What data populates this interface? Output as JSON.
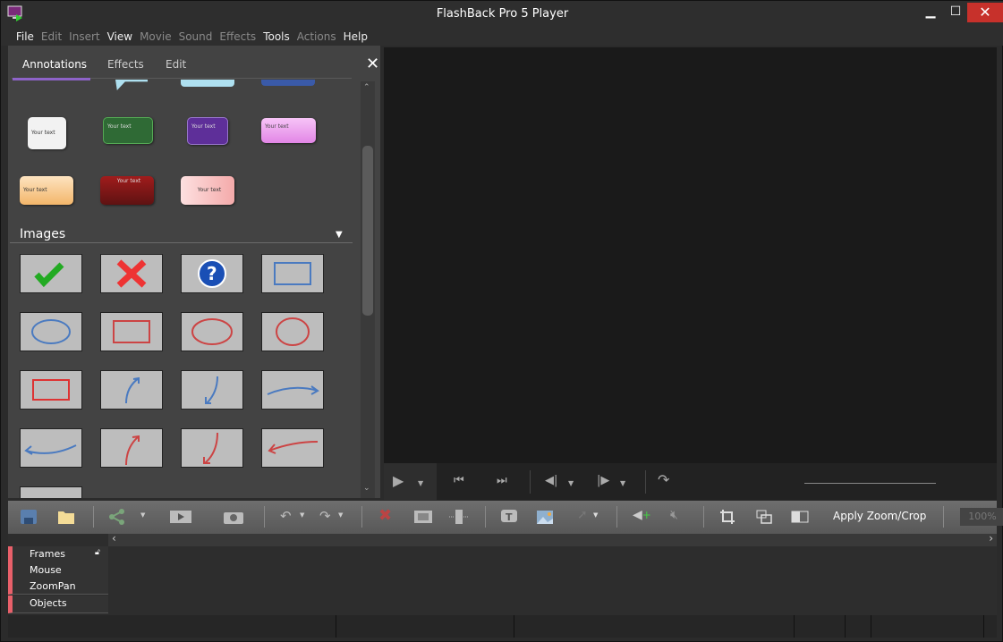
{
  "window": {
    "title": "FlashBack Pro 5 Player",
    "minimize": "▁",
    "maximize": "☐",
    "close": "✕"
  },
  "menu": [
    {
      "label": "File",
      "enabled": true
    },
    {
      "label": "Edit",
      "enabled": false
    },
    {
      "label": "Insert",
      "enabled": false
    },
    {
      "label": "View",
      "enabled": true
    },
    {
      "label": "Movie",
      "enabled": false
    },
    {
      "label": "Sound",
      "enabled": false
    },
    {
      "label": "Effects",
      "enabled": false
    },
    {
      "label": "Tools",
      "enabled": true
    },
    {
      "label": "Actions",
      "enabled": false
    },
    {
      "label": "Help",
      "enabled": true
    }
  ],
  "panel": {
    "tabs": [
      "Annotations",
      "Effects",
      "Edit"
    ],
    "active_tab": "Annotations",
    "close": "✕",
    "callouts": [
      {
        "text": "Your text",
        "color": "#f2f2f2",
        "fg": "#333"
      },
      {
        "text": "Your text",
        "color": "#2f6a35",
        "fg": "#ddd"
      },
      {
        "text": "Your text",
        "color": "#5e2f99",
        "fg": "#ddd"
      },
      {
        "text": "Your text",
        "color": "#f0a6f0",
        "fg": "#444"
      },
      {
        "text": "Your text",
        "color": "#f8c888",
        "fg": "#333"
      },
      {
        "text": "Your text",
        "color": "#8a1a1a",
        "fg": "#ddd"
      },
      {
        "text": "Your text",
        "color": "#f8c8c8",
        "fg": "#333"
      }
    ],
    "images_section": "Images",
    "images": [
      "green-checkmark",
      "red-x",
      "blue-question",
      "blue-rectangle",
      "blue-ellipse",
      "red-rectangle",
      "red-ellipse",
      "red-circle",
      "red-rectangle-small",
      "blue-arrow-up-right",
      "blue-arrow-down-left",
      "blue-arrow-right",
      "blue-arrow-left",
      "red-arrow-up-right",
      "red-arrow-down-left",
      "red-arrow-left"
    ]
  },
  "toolbar": {
    "apply_zoom_crop": "Apply Zoom/Crop",
    "zoom": "100%"
  },
  "timeline": {
    "tracks": [
      "Frames",
      "Mouse",
      "ZoomPan",
      "Objects"
    ]
  },
  "colors": {
    "accent": "#8e63c9",
    "track_marker": "#e8606a"
  }
}
